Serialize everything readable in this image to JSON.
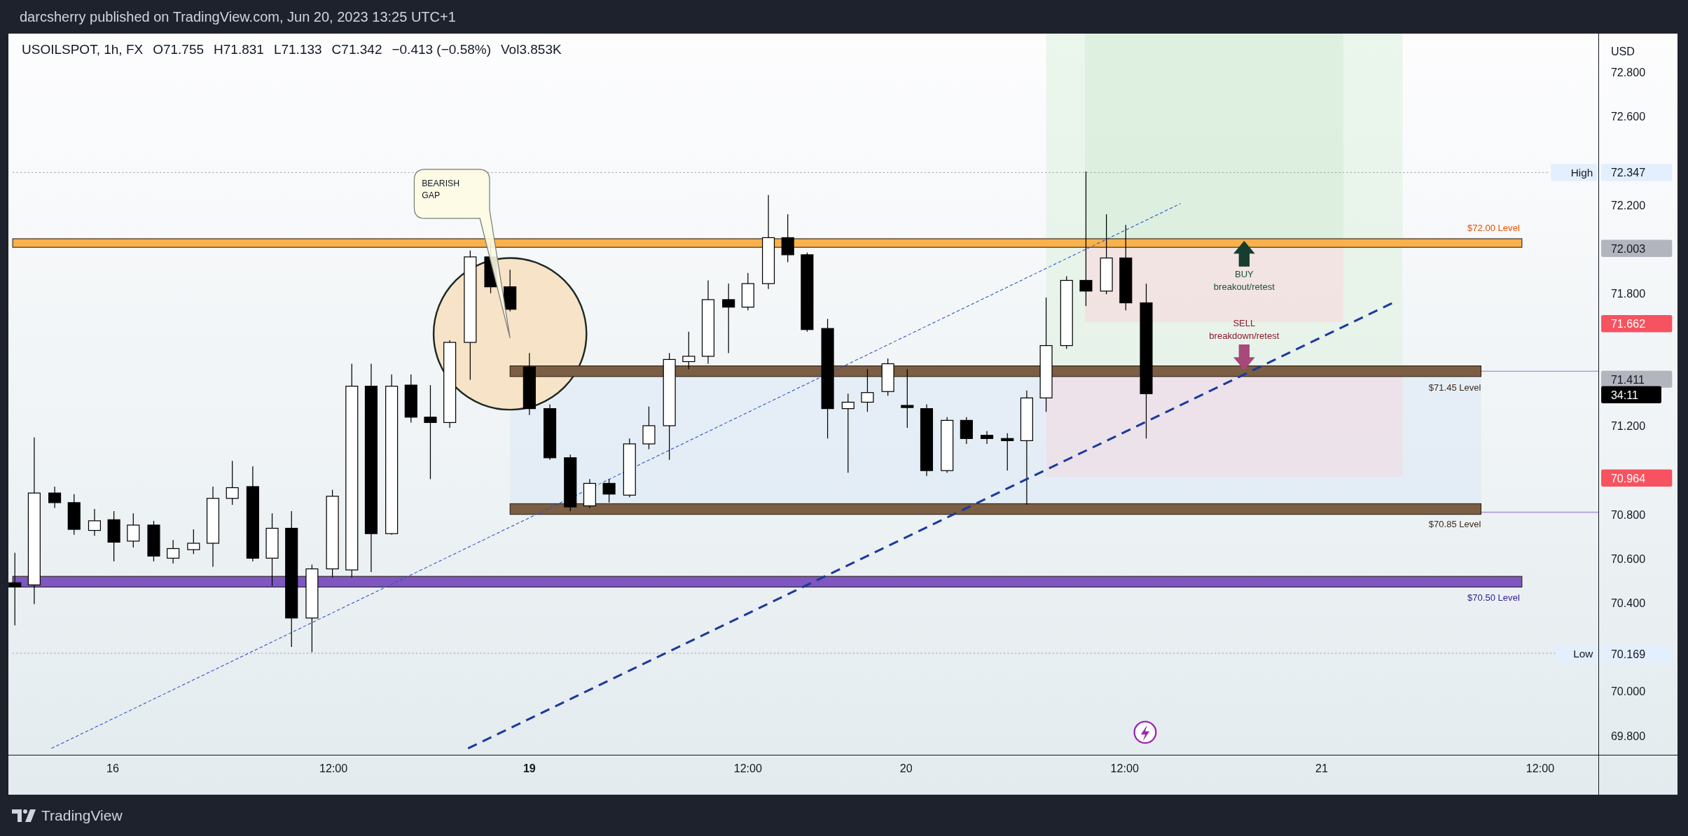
{
  "header": {
    "publisher_line": "darcsherry published on TradingView.com, Jun 20, 2023 13:25 UTC+1"
  },
  "legend": {
    "symbol": "USOILSPOT, 1h, FX",
    "values": [
      "O71.755",
      "H71.831",
      "L71.133",
      "C71.342",
      "−0.413 (−0.58%)",
      "Vol3.853K"
    ]
  },
  "levels": [
    {
      "label": "$72.00 Level",
      "color": "#f9b24b"
    },
    {
      "label": "$71.45 Level",
      "color": "#7b5e44"
    },
    {
      "label": "$70.85 Level",
      "color": "#7b5e44"
    },
    {
      "label": "$70.50 Level",
      "color": "#7e57c2"
    }
  ],
  "annotations": {
    "callout": [
      "BEARISH",
      "GAP"
    ],
    "buy": [
      "BUY",
      "breakout/retest"
    ],
    "sell": [
      "SELL",
      "breakdown/retest"
    ]
  },
  "price_axis": {
    "currency": "USD",
    "ticks": [
      "72.800",
      "72.600",
      "72.200",
      "71.800",
      "71.200",
      "70.800",
      "70.600",
      "70.400",
      "70.000",
      "69.800"
    ],
    "tags": [
      {
        "kind": "high",
        "label": "High",
        "value": "72.347"
      },
      {
        "kind": "gray",
        "value": "72.003"
      },
      {
        "kind": "red",
        "value": "71.662"
      },
      {
        "kind": "gray",
        "value": "71.411"
      },
      {
        "kind": "countdown",
        "value": "34:11"
      },
      {
        "kind": "red",
        "value": "70.964"
      },
      {
        "kind": "low",
        "label": "Low",
        "value": "70.169"
      }
    ]
  },
  "time_axis": {
    "labels": [
      {
        "text": "16",
        "bold": false
      },
      {
        "text": "12:00",
        "bold": false
      },
      {
        "text": "19",
        "bold": true
      },
      {
        "text": "12:00",
        "bold": false
      },
      {
        "text": "20",
        "bold": false
      },
      {
        "text": "12:00",
        "bold": false
      },
      {
        "text": "21",
        "bold": false
      },
      {
        "text": "12:00",
        "bold": false
      }
    ]
  },
  "footer": {
    "brand": "TradingView"
  }
}
